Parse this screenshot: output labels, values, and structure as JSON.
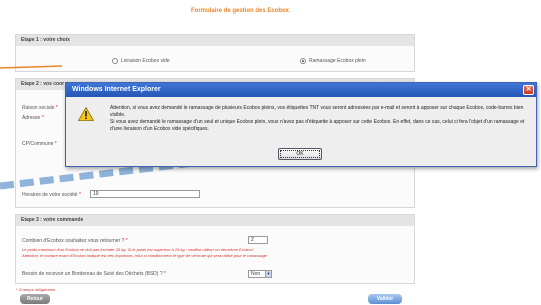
{
  "page": {
    "title": "Formulaire de gestion des Ecobox"
  },
  "step1": {
    "title": "Etape 1 : votre choix",
    "option_delivery": "Livraison Ecobox vide",
    "option_pickup": "Ramassage Ecobox plein"
  },
  "step2": {
    "title": "Etape 2 : vos coor",
    "raison_sociale_label": "Raison sociale",
    "adresse_label": "Adresse",
    "cp_commune_label": "CP/Commune",
    "horaires_label": "Horaires de votre société",
    "horaires_value": "19"
  },
  "step3": {
    "title": "Etape 3 : votre commande",
    "quantity_label": "Combien d'Ecobox souhaitez vous retourner ?",
    "quantity_value": "2",
    "note_line1": "Le poids maximum d'un Ecobox ne doit pas excéder 25 kg. Si le poids est supérieur à 25 kg : veuillez utiliser un deuxième Ecobox!",
    "note_line2": "Attention, le nombre exact d'Ecobox indiqué est très important, celui-ci conditionnera le type de véhicule qui sera utilisé pour le ramassage",
    "bsd_label": "Besoin de recevoir un Bordereau de Suivi des Déchets (BSD) ?",
    "bsd_value": "Non"
  },
  "required_note": "* Champs obligatoires",
  "buttons": {
    "back": "Retour",
    "submit": "Valider"
  },
  "dialog": {
    "title": "Windows Internet Explorer",
    "icon": "warning-icon",
    "message_1": "Attention, si vous avez demandé le ramassage de plusieurs Ecobox pleins, vos étiquettes TNT vous seront adressées par e-mail et seront à apposer sur chaque Ecobox, code-barres bien visible.",
    "message_2": "Si vous avez demandé le ramassage d'un seul et unique Ecobox plein, vous n'avez pas d'étiquette à apposer sur cette Ecobox. En effet, dans ce cas, celui ci fera l'objet d'un ramassage et d'une livraison d'un Ecobox vide spécifiques.",
    "ok_label": "OK"
  },
  "colors": {
    "accent_orange": "#e8862b",
    "dialog_titlebar": "#2456b4",
    "dashed_line": "#8fb3da",
    "warning_text": "#d43030"
  }
}
